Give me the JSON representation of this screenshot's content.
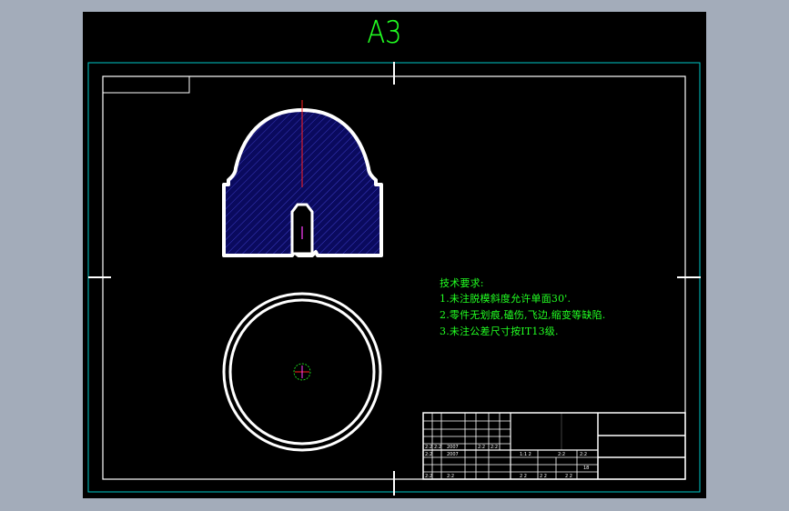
{
  "sheet": {
    "size_label": "A3",
    "background_color": "#000000",
    "frame_color": "#ffffff",
    "outer_border_color": "#00c8c8",
    "hatch_color": "#1a1a80",
    "text_color": "#22ff22",
    "centerline_color": "#ff2020"
  },
  "technical_requirements": {
    "title": "技术要求:",
    "items": [
      "1.未注脱模斜度允许单面30'.",
      "2.零件无划痕,磕伤,飞边,缩变等缺陷.",
      "3.未注公差尺寸按IT13级."
    ]
  },
  "title_block": {
    "cells": [
      "2:2",
      "2:2",
      "2007",
      "2:2",
      "2:2",
      "2:2",
      "2007",
      "1:1 2",
      "2:2",
      "2:2",
      "2:2",
      "2:2",
      "2 2",
      "2 2",
      "2 2",
      "18"
    ]
  }
}
